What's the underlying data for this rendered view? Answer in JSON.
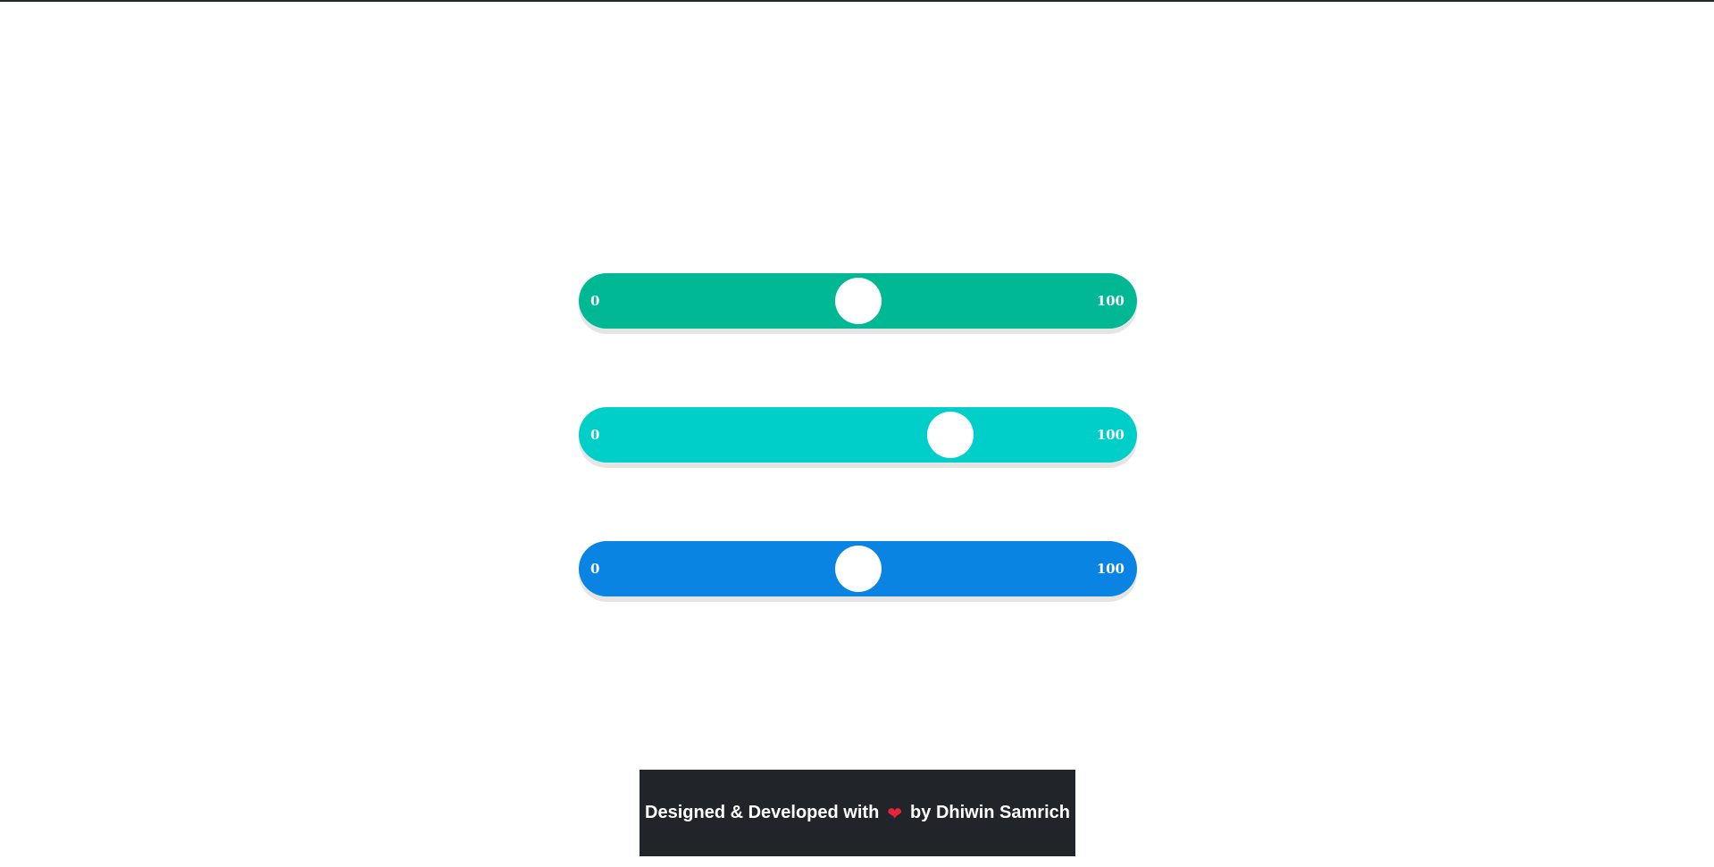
{
  "sliders": [
    {
      "min_label": "0",
      "max_label": "100",
      "value": 50,
      "color": "#00b894"
    },
    {
      "min_label": "0",
      "max_label": "100",
      "value": 68,
      "color": "#00cec9"
    },
    {
      "min_label": "0",
      "max_label": "100",
      "value": 50,
      "color": "#0984e3"
    }
  ],
  "footer": {
    "prefix": "Designed & Developed with",
    "icon": "heart-icon",
    "suffix": "by Dhiwin Samrich",
    "background": "#212529",
    "heart_color": "#e8223a"
  }
}
